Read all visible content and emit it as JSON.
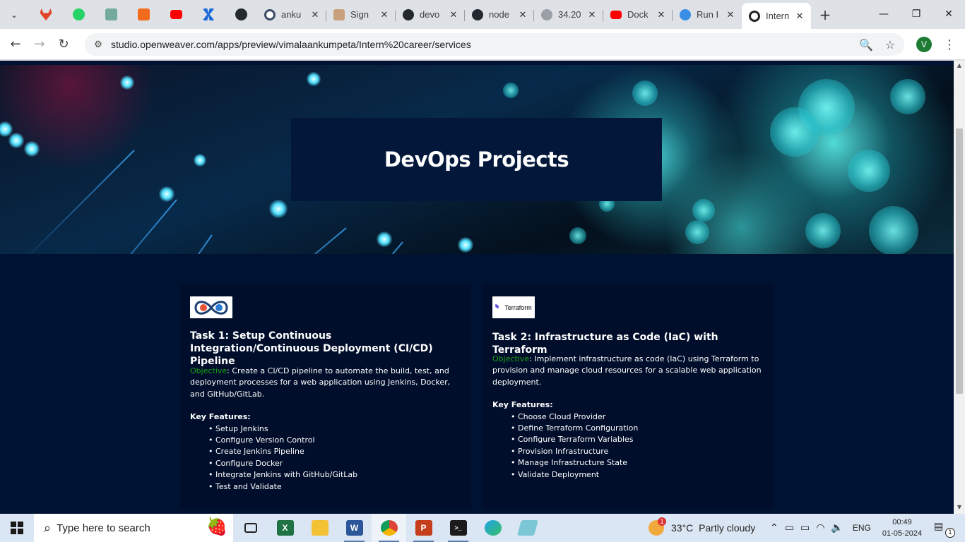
{
  "browser": {
    "tabs": [
      {
        "label": "anku",
        "icon": "github-icon"
      },
      {
        "label": "Sign",
        "icon": "user-photo-icon"
      },
      {
        "label": "devo",
        "icon": "github-icon"
      },
      {
        "label": "node",
        "icon": "github-icon"
      },
      {
        "label": "34.20",
        "icon": "globe-icon"
      },
      {
        "label": "Dock",
        "icon": "youtube-icon"
      },
      {
        "label": "Run I",
        "icon": "edge-icon"
      },
      {
        "label": "Intern",
        "icon": "openweaver-icon",
        "active": true
      }
    ],
    "url": "studio.openweaver.com/apps/preview/vimalaankumpeta/Intern%20career/services",
    "profile_initial": "V"
  },
  "hero": {
    "title": "DevOps Projects"
  },
  "cards": [
    {
      "logo": "devops-infinity-logo",
      "title": "Task 1: Setup Continuous Integration/Continuous Deployment (CI/CD) Pipeline",
      "objective_label": "Objective",
      "objective_text": ": Create a CI/CD pipeline to automate the build, test, and deployment processes for a web application using Jenkins, Docker, and GitHub/GitLab.",
      "key_features_label": "Key Features:",
      "features": [
        "Setup Jenkins",
        "Configure Version Control",
        "Create Jenkins Pipeline",
        "Configure Docker",
        "Integrate Jenkins with GitHub/GitLab",
        "Test and Validate"
      ]
    },
    {
      "logo_text": "Terraform",
      "title": "Task 2: Infrastructure as Code (IaC) with Terraform",
      "objective_label": "Objective",
      "objective_text": ": Implement infrastructure as code (IaC) using Terraform to provision and manage cloud resources for a scalable web application deployment.",
      "key_features_label": "Key Features:",
      "features": [
        "Choose Cloud Provider",
        "Define Terraform Configuration",
        "Configure Terraform Variables",
        "Provision Infrastructure",
        "Manage Infrastructure State",
        " Validate Deployment"
      ]
    }
  ],
  "taskbar": {
    "search_placeholder": "Type here to search",
    "weather_temp": "33°C",
    "weather_desc": "Partly cloudy",
    "weather_badge": "1",
    "language": "ENG",
    "time": "00:49",
    "date": "01-05-2024",
    "notification_count": "1"
  },
  "colors": {
    "page_bg": "#001232",
    "card_bg": "#010e2b",
    "objective": "#17a317",
    "hero_box": "#02173a"
  }
}
